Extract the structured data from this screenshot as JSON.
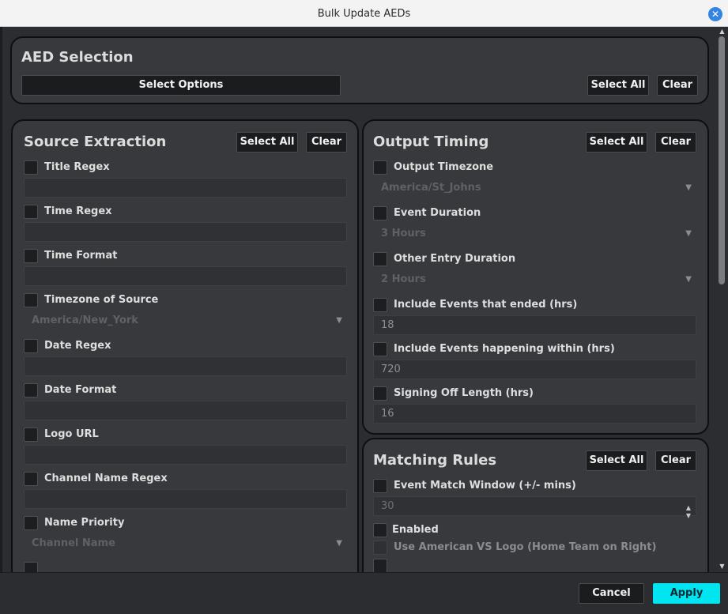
{
  "window": {
    "title": "Bulk Update AEDs",
    "close_icon": "close-icon"
  },
  "aed_selection": {
    "title": "AED Selection",
    "select_options_label": "Select Options",
    "select_all_label": "Select All",
    "clear_label": "Clear"
  },
  "source_extraction": {
    "title": "Source Extraction",
    "select_all_label": "Select All",
    "clear_label": "Clear",
    "title_regex": {
      "label": "Title Regex",
      "value": ""
    },
    "time_regex": {
      "label": "Time Regex",
      "value": ""
    },
    "time_format": {
      "label": "Time Format",
      "value": ""
    },
    "timezone_of_source": {
      "label": "Timezone of Source",
      "value": "America/New_York"
    },
    "date_regex": {
      "label": "Date Regex",
      "value": ""
    },
    "date_format": {
      "label": "Date Format",
      "value": ""
    },
    "logo_url": {
      "label": "Logo URL",
      "value": ""
    },
    "channel_name_regex": {
      "label": "Channel Name Regex",
      "value": ""
    },
    "name_priority": {
      "label": "Name Priority",
      "value": "Channel Name"
    }
  },
  "output_timing": {
    "title": "Output Timing",
    "select_all_label": "Select All",
    "clear_label": "Clear",
    "output_timezone": {
      "label": "Output Timezone",
      "value": "America/St_Johns"
    },
    "event_duration": {
      "label": "Event Duration",
      "value": "3 Hours"
    },
    "other_entry_duration": {
      "label": "Other Entry Duration",
      "value": "2 Hours"
    },
    "include_ended": {
      "label": "Include Events that ended (hrs)",
      "value": "18"
    },
    "include_within": {
      "label": "Include Events happening within (hrs)",
      "value": "720"
    },
    "signing_off": {
      "label": "Signing Off Length (hrs)",
      "value": "16"
    }
  },
  "matching_rules": {
    "title": "Matching Rules",
    "select_all_label": "Select All",
    "clear_label": "Clear",
    "event_match_window": {
      "label": "Event Match Window (+/- mins)",
      "value": "30"
    },
    "enabled_label": "Enabled",
    "american_vs_logo_label": "Use American VS Logo (Home Team on Right)"
  },
  "footer": {
    "cancel_label": "Cancel",
    "apply_label": "Apply"
  },
  "colors": {
    "accent": "#00e5ef",
    "background": "#2b2d30",
    "panel": "#37393c"
  }
}
